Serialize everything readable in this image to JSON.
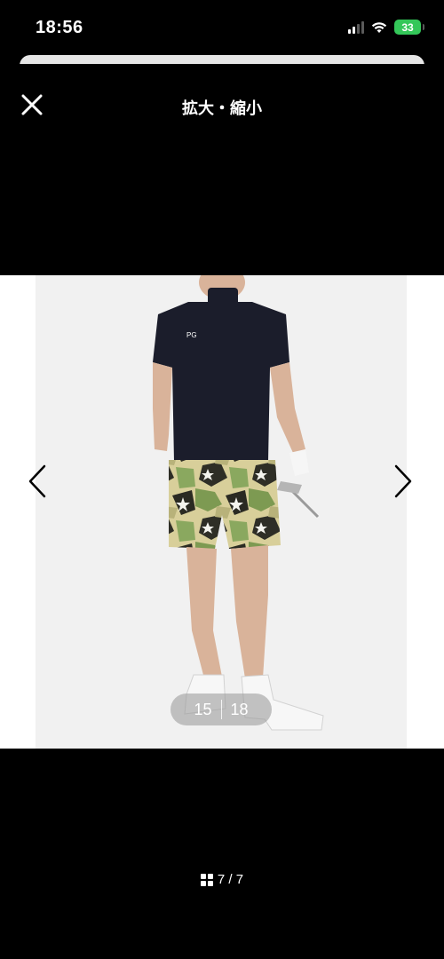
{
  "status_bar": {
    "time": "18:56",
    "battery": "33",
    "icons": [
      "signal-icon",
      "wifi-icon",
      "battery-charging-icon"
    ]
  },
  "header": {
    "title": "拡大・縮小",
    "close_icon": "close-icon"
  },
  "viewer": {
    "image_counter_current": "15",
    "image_counter_total": "18",
    "prev_icon": "chevron-left-icon",
    "next_icon": "chevron-right-icon"
  },
  "footer": {
    "page_indicator": "7 / 7",
    "grid_icon": "grid-icon"
  },
  "colors": {
    "background": "#000000",
    "battery": "#34c759",
    "photo_background": "#f2f2f2"
  }
}
